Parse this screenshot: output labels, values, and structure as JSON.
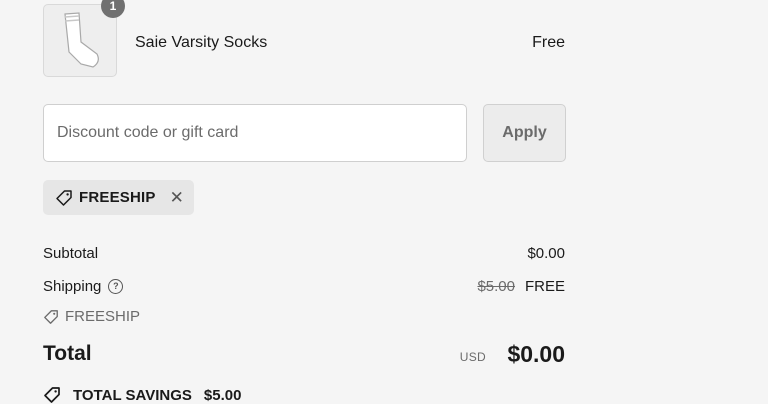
{
  "cart_item": {
    "quantity": "1",
    "name": "Saie Varsity Socks",
    "price": "Free",
    "thumbnail_icon": "sock-icon"
  },
  "discount": {
    "placeholder": "Discount code or gift card",
    "value": "",
    "apply_label": "Apply"
  },
  "applied_code": {
    "code": "FREESHIP",
    "icon": "tag-icon",
    "remove_icon": "close-icon"
  },
  "summary": {
    "subtotal_label": "Subtotal",
    "subtotal_value": "$0.00",
    "shipping_label": "Shipping",
    "shipping_help_icon": "?",
    "shipping_original": "$5.00",
    "shipping_value": "FREE",
    "shipping_code": "FREESHIP",
    "total_label": "Total",
    "currency": "USD",
    "total_value": "$0.00",
    "savings_label": "TOTAL SAVINGS",
    "savings_value": "$5.00"
  },
  "colors": {
    "background": "#f5f5f5",
    "muted_text": "#6b6b6b",
    "badge": "#707070"
  }
}
